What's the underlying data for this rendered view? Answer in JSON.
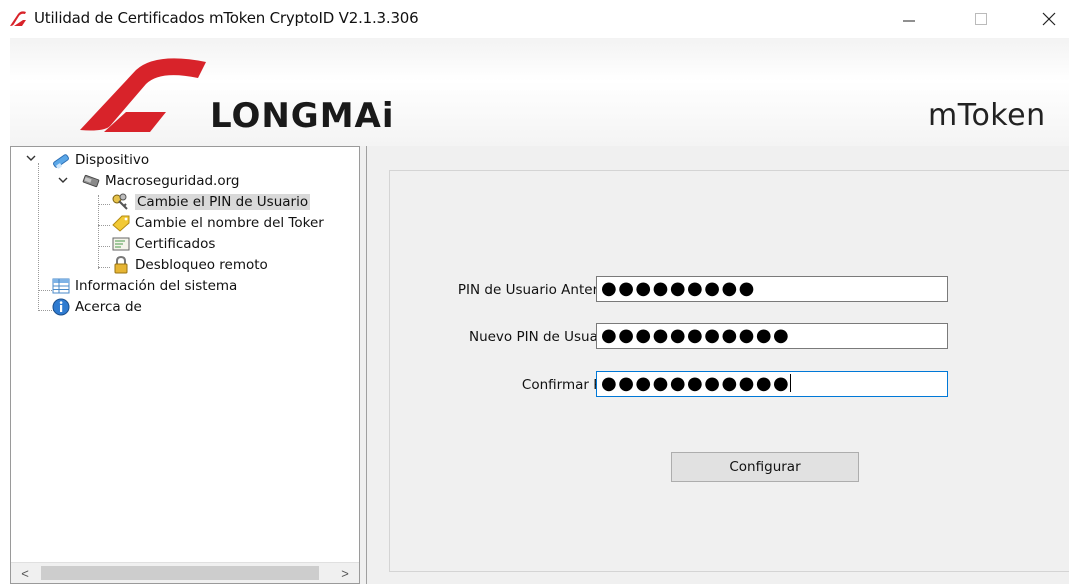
{
  "window": {
    "title": "Utilidad de Certificados mToken CryptoID  V2.1.3.306",
    "minimize_glyph": "—",
    "maximize_glyph": "☐",
    "close_glyph": "✕"
  },
  "banner": {
    "brand_text": "LONGMAi",
    "product_text": "mToken",
    "brand_color": "#d8232a"
  },
  "tree": {
    "nodes": [
      {
        "label": "Dispositivo",
        "icon": "usb-token-icon"
      },
      {
        "label": "Macroseguridad.org",
        "icon": "usb-drive-icon"
      },
      {
        "label": "Cambie el PIN de Usuario",
        "icon": "keys-icon",
        "selected": true
      },
      {
        "label": "Cambie el nombre del Toker",
        "icon": "tag-icon"
      },
      {
        "label": "Certificados",
        "icon": "certificate-icon"
      },
      {
        "label": "Desbloqueo remoto",
        "icon": "lock-icon"
      },
      {
        "label": "Información del sistema",
        "icon": "table-icon"
      },
      {
        "label": "Acerca de",
        "icon": "info-icon"
      }
    ],
    "scroll_left": "<",
    "scroll_right": ">"
  },
  "form": {
    "old_pin_label": "PIN de Usuario Anterior:",
    "old_pin_value": "●●●●●●●●●",
    "new_pin_label": "Nuevo PIN de Usuario:",
    "new_pin_value": "●●●●●●●●●●●",
    "confirm_pin_label": "Confirmar PIN:",
    "confirm_pin_value": "●●●●●●●●●●●",
    "submit_label": "Configurar"
  }
}
